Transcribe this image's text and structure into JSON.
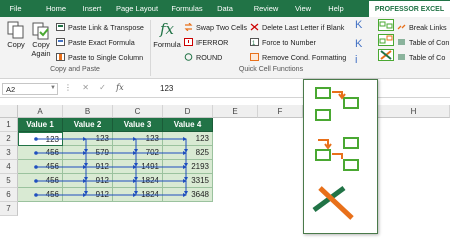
{
  "ribbon_tabs": [
    {
      "label": "File"
    },
    {
      "label": "Home"
    },
    {
      "label": "Insert"
    },
    {
      "label": "Page Layout"
    },
    {
      "label": "Formulas"
    },
    {
      "label": "Data"
    },
    {
      "label": "Review"
    },
    {
      "label": "View"
    },
    {
      "label": "Help"
    },
    {
      "label": "PROFESSOR EXCEL"
    }
  ],
  "groups": {
    "copy_paste": {
      "label": "Copy and Paste",
      "copy": "Copy",
      "copy_again": "Copy\nAgain",
      "paste_link_transpose": "Paste Link & Transpose",
      "paste_exact_formula": "Paste Exact Formula",
      "paste_single_column": "Paste to Single Column"
    },
    "quick_cell": {
      "label": "Quick Cell Functions",
      "formula": "Formula",
      "swap_two_cells": "Swap Two Cells",
      "iferror": "IFERROR",
      "round": "ROUND",
      "delete_last_letter": "Delete Last Letter if Blank",
      "force_to_number": "Force to Number",
      "remove_cond_formatting": "Remove Cond. Formatting"
    },
    "right": {
      "break_links": "Break Links",
      "table_of_contents_1": "Table of Con",
      "table_of_contents_2": "Table of Co"
    }
  },
  "formula_bar": {
    "name_box": "A2",
    "fx_label": "fx",
    "value": "123"
  },
  "columns": [
    "A",
    "B",
    "C",
    "D",
    "E",
    "F",
    "G",
    "H"
  ],
  "rows": [
    "1",
    "2",
    "3",
    "4",
    "5",
    "6",
    "7"
  ],
  "table": {
    "headers": [
      "Value 1",
      "Value 2",
      "Value 3",
      "Value 4"
    ],
    "data": [
      [
        "123",
        "123",
        "123",
        "123"
      ],
      [
        "456",
        "579",
        "702",
        "825"
      ],
      [
        "456",
        "912",
        "1491",
        "2193"
      ],
      [
        "456",
        "912",
        "1824",
        "3315"
      ],
      [
        "456",
        "912",
        "1824",
        "3648"
      ]
    ]
  },
  "colors": {
    "excel_green": "#217346",
    "cell_fill": "#d9ead3",
    "arrow_blue": "#1f4fbf",
    "icon_orange": "#e8701a",
    "icon_green": "#4aa832"
  }
}
